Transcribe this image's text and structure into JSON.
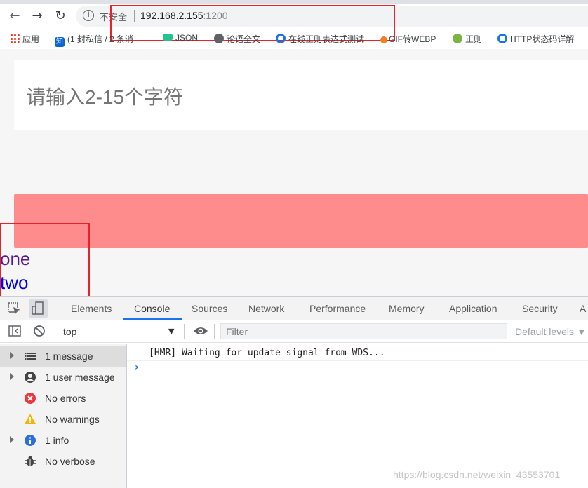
{
  "browser": {
    "security_label": "不安全",
    "url_host": "192.168.2.155",
    "url_port": ":1200",
    "bookmarks": [
      {
        "label": "应用",
        "icon": "apps-grid-icon"
      },
      {
        "label": "(1 封私信 / 2 条消",
        "icon": "zhihu-icon"
      },
      {
        "label": "JSON",
        "icon": "json-icon"
      },
      {
        "label": "论语全文",
        "icon": "globe-icon"
      },
      {
        "label": "在线正则表达式测试",
        "icon": "c-icon"
      },
      {
        "label": "GIF转WEBP",
        "icon": "convert-icon"
      },
      {
        "label": "正则",
        "icon": "owl-icon"
      },
      {
        "label": "HTTP状态码详解",
        "icon": "c-icon"
      }
    ]
  },
  "page": {
    "input_placeholder": "请输入2-15个字符",
    "link_one": "one",
    "link_two": "two"
  },
  "devtools": {
    "tabs": [
      "Elements",
      "Console",
      "Sources",
      "Network",
      "Performance",
      "Memory",
      "Application",
      "Security",
      "A"
    ],
    "active_tab": "Console",
    "context": "top",
    "filter_placeholder": "Filter",
    "levels": "Default levels ▼",
    "sidebar": [
      {
        "label": "1 message",
        "icon": "list-icon",
        "expandable": true
      },
      {
        "label": "1 user message",
        "icon": "user-icon",
        "expandable": true
      },
      {
        "label": "No errors",
        "icon": "error-icon",
        "expandable": false
      },
      {
        "label": "No warnings",
        "icon": "warning-icon",
        "expandable": false
      },
      {
        "label": "1 info",
        "icon": "info-icon",
        "expandable": true
      },
      {
        "label": "No verbose",
        "icon": "bug-icon",
        "expandable": false
      }
    ],
    "console_messages": [
      "[HMR] Waiting for update signal from WDS..."
    ]
  },
  "watermark": "https://blog.csdn.net/weixin_43553701",
  "colors": {
    "highlight_box": "#e8212a",
    "button": "#fe8c8c",
    "active_tab_underline": "#1a73e8",
    "visited_link": "#551a8b",
    "link": "#0000ee"
  }
}
